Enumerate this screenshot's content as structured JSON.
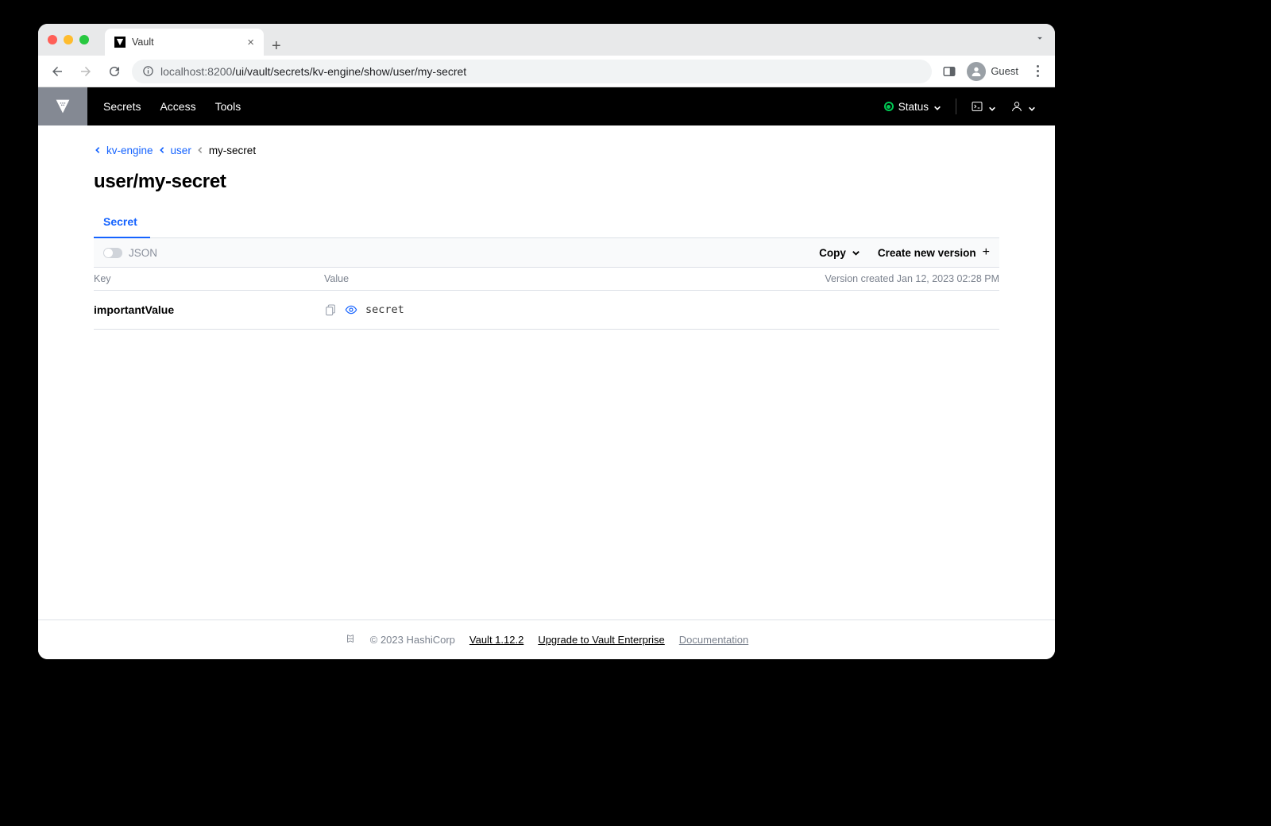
{
  "browser": {
    "tab_title": "Vault",
    "url_host": "localhost",
    "url_port": ":8200",
    "url_path": "/ui/vault/secrets/kv-engine/show/user/my-secret",
    "guest_label": "Guest"
  },
  "header": {
    "nav": {
      "secrets": "Secrets",
      "access": "Access",
      "tools": "Tools"
    },
    "status_label": "Status"
  },
  "breadcrumbs": {
    "item0": "kv-engine",
    "item1": "user",
    "current": "my-secret"
  },
  "page": {
    "title": "user/my-secret",
    "tab_secret": "Secret"
  },
  "toolbar": {
    "json_label": "JSON",
    "copy_label": "Copy",
    "create_label": "Create new version"
  },
  "table": {
    "col_key": "Key",
    "col_value": "Value",
    "version_created": "Version created Jan 12, 2023 02:28 PM"
  },
  "rows": [
    {
      "key": "importantValue",
      "value": "secret"
    }
  ],
  "footer": {
    "copyright": "© 2023 HashiCorp",
    "version": "Vault 1.12.2",
    "upgrade": "Upgrade to Vault Enterprise",
    "docs": "Documentation"
  }
}
